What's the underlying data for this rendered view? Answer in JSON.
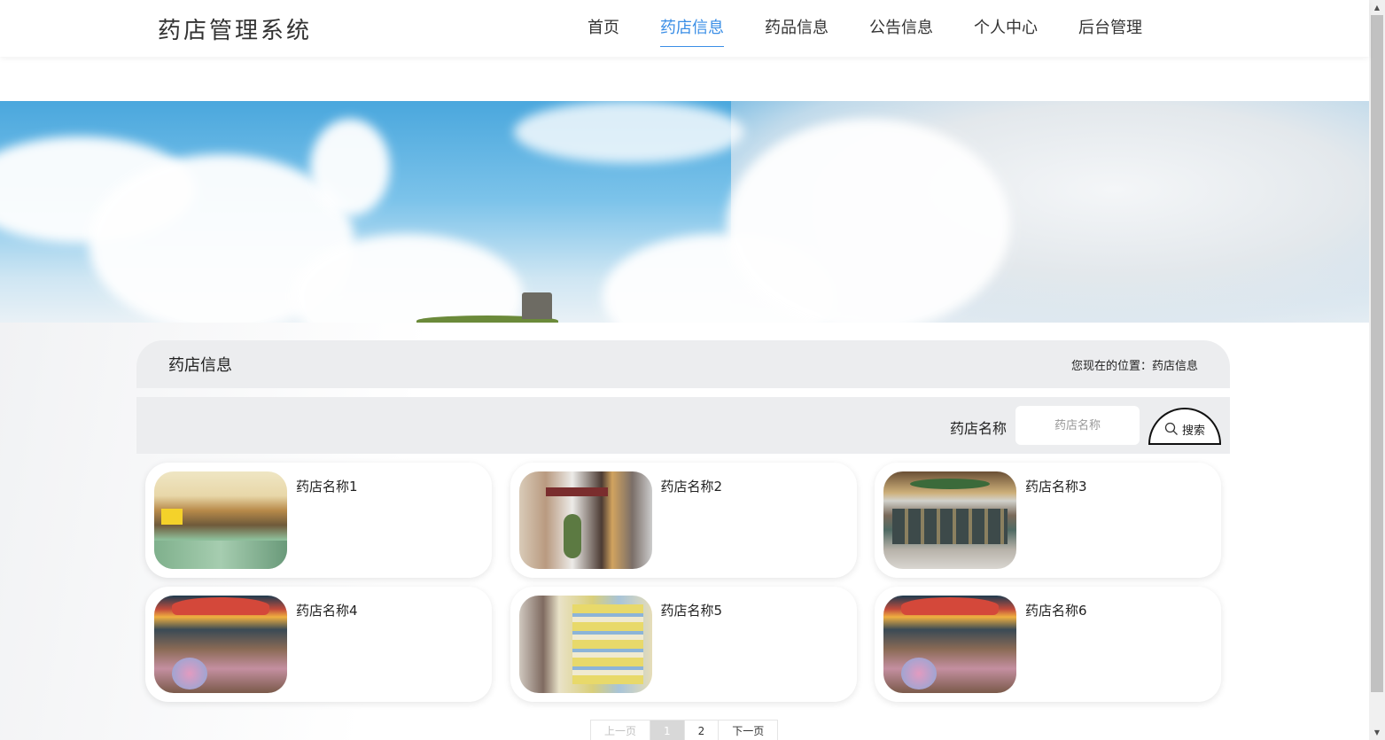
{
  "brand": {
    "title": "药店管理系统"
  },
  "nav": {
    "items": [
      {
        "label": "首页"
      },
      {
        "label": "药店信息"
      },
      {
        "label": "药品信息"
      },
      {
        "label": "公告信息"
      },
      {
        "label": "个人中心"
      },
      {
        "label": "后台管理"
      }
    ],
    "active_index": 1,
    "active_color": "#3a8ee6"
  },
  "section": {
    "title": "药店信息",
    "breadcrumb_prefix": "您现在的位置：",
    "breadcrumb_current": "药店信息"
  },
  "search": {
    "label": "药店名称",
    "placeholder": "药店名称",
    "value": "",
    "button_label": "搜索",
    "button_icon": "search-icon"
  },
  "stores": [
    {
      "name": "药店名称1"
    },
    {
      "name": "药店名称2"
    },
    {
      "name": "药店名称3"
    },
    {
      "name": "药店名称4"
    },
    {
      "name": "药店名称5"
    },
    {
      "name": "药店名称6"
    }
  ],
  "pager": {
    "prev": "上一页",
    "pages": [
      "1",
      "2"
    ],
    "current": "1",
    "next": "下一页"
  }
}
